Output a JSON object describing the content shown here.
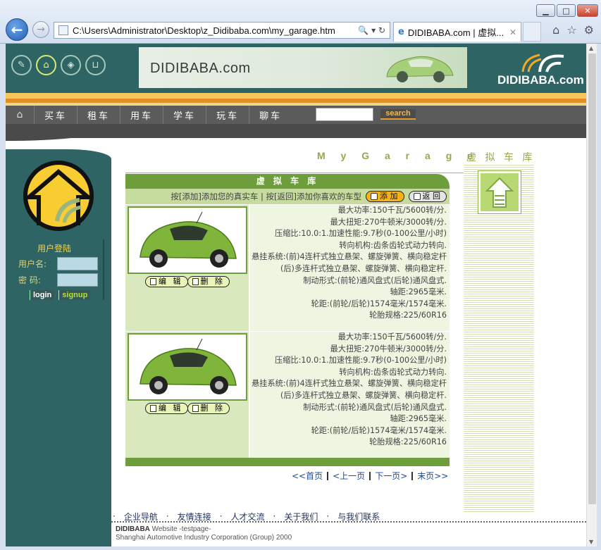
{
  "browser": {
    "url": "C:\\Users\\Administrator\\Desktop\\z_Didibaba.com\\my_garage.htm",
    "tab_title": "DIDIBABA.com | 虚拟...",
    "address_controls": "🔍 ▾ ↻"
  },
  "header": {
    "banner_text": "DIDIBABA.com",
    "logo_text": "DIDIBABA.com"
  },
  "nav": {
    "items": [
      "买车",
      "租车",
      "用车",
      "学车",
      "玩车",
      "聊车"
    ],
    "search_button": "search"
  },
  "login": {
    "title": "用户登陆",
    "username_label": "用户名:",
    "password_label": "密  码:",
    "login_button": "login",
    "signup_button": "signup"
  },
  "garage": {
    "heading_en": "M y G a r a g e",
    "heading_cn": "虚 拟 车 库",
    "panel_title": "虚 拟 车 库",
    "instructions": "按[添加]添加您的真实车 | 按[返回]添加你喜欢的车型",
    "add_button": "添 加",
    "back_button": "返 回",
    "edit_button": "编 辑",
    "delete_button": "删 除",
    "items": [
      {
        "specs": [
          "最大功率:150千瓦/5600转/分.",
          "最大扭矩:270牛顿米/3000转/分.",
          "压缩比:10.0:1.加速性能:9.7秒(0-100公里/小时)",
          "转向机构:齿条齿轮式动力转向.",
          "悬挂系统:(前)4连杆式独立悬架、螺旋弹簧、横向稳定杆(后)多连杆式独立悬架、螺旋弹簧、横向稳定杆.",
          "制动形式:(前轮)通风盘式(后轮)通风盘式.",
          "轴距:2965毫米.",
          "轮距:(前轮/后轮)1574毫米/1574毫米.",
          "轮胎规格:225/60R16"
        ]
      },
      {
        "specs": [
          "最大功率:150千瓦/5600转/分.",
          "最大扭矩:270牛顿米/3000转/分.",
          "压缩比:10.0:1.加速性能:9.7秒(0-100公里/小时)",
          "转向机构:齿条齿轮式动力转向.",
          "悬挂系统:(前)4连杆式独立悬架、螺旋弹簧、横向稳定杆(后)多连杆式独立悬架、螺旋弹簧、横向稳定杆.",
          "制动形式:(前轮)通风盘式(后轮)通风盘式.",
          "轴距:2965毫米.",
          "轮距:(前轮/后轮)1574毫米/1574毫米.",
          "轮胎规格:225/60R16"
        ]
      }
    ],
    "pager": [
      "<<首页",
      "<上一页",
      "下一页>",
      "末页>>"
    ]
  },
  "footer": {
    "links": [
      "企业导航",
      "友情连接",
      "人才交流",
      "关于我们",
      "与我们联系"
    ],
    "brand": "DIDIBABA",
    "line1": "Website -testpage-",
    "line2": "Shanghai Automotive Industry Corporation (Group) 2000"
  }
}
